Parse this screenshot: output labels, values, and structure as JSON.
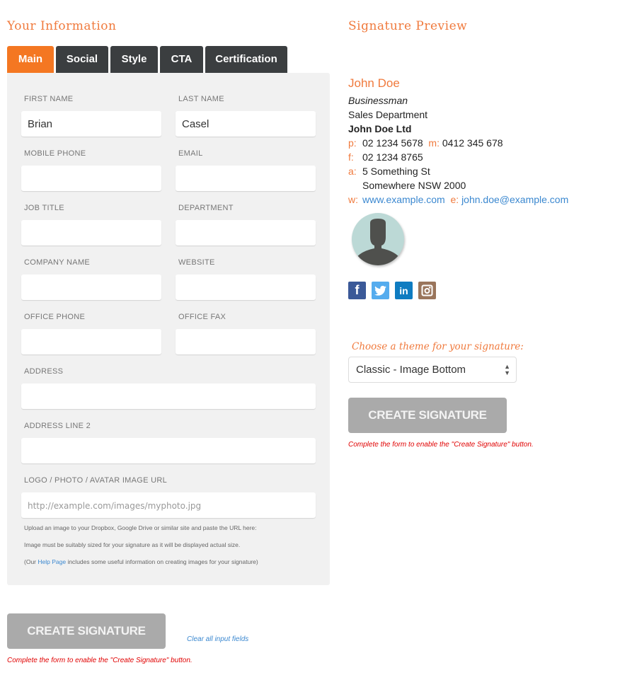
{
  "left": {
    "title": "Your Information",
    "tabs": [
      {
        "label": "Main",
        "active": true
      },
      {
        "label": "Social",
        "active": false
      },
      {
        "label": "Style",
        "active": false
      },
      {
        "label": "CTA",
        "active": false
      },
      {
        "label": "Certification",
        "active": false
      }
    ],
    "fields": {
      "first_name": {
        "label": "FIRST NAME",
        "value": "Brian"
      },
      "last_name": {
        "label": "LAST NAME",
        "value": "Casel"
      },
      "mobile_phone": {
        "label": "MOBILE PHONE",
        "value": ""
      },
      "email": {
        "label": "EMAIL",
        "value": ""
      },
      "job_title": {
        "label": "JOB TITLE",
        "value": ""
      },
      "department": {
        "label": "DEPARTMENT",
        "value": ""
      },
      "company_name": {
        "label": "COMPANY NAME",
        "value": ""
      },
      "website": {
        "label": "WEBSITE",
        "value": ""
      },
      "office_phone": {
        "label": "OFFICE PHONE",
        "value": ""
      },
      "office_fax": {
        "label": "OFFICE FAX",
        "value": ""
      },
      "address": {
        "label": "ADDRESS",
        "value": ""
      },
      "address2": {
        "label": "ADDRESS LINE 2",
        "value": ""
      },
      "image_url": {
        "label": "LOGO / PHOTO / AVATAR IMAGE URL",
        "value": "",
        "placeholder": "http://example.com/images/myphoto.jpg"
      }
    },
    "help": {
      "line1": "Upload an image to your Dropbox, Google Drive or similar site and paste the URL here:",
      "line2": "Image must be suitably sized for your signature as it will be displayed actual size.",
      "line3_prefix": "(Our ",
      "line3_link": "Help Page",
      "line3_suffix": " includes some useful information on creating images for your signature)"
    },
    "create_button": "CREATE SIGNATURE",
    "clear_link": "Clear all input fields",
    "warning": "Complete the form to enable the \"Create Signature\" button."
  },
  "right": {
    "title": "Signature Preview",
    "signature": {
      "name": "John Doe",
      "job_title": "Businessman",
      "department": "Sales Department",
      "company": "John Doe Ltd",
      "phone_label": "p:",
      "phone": "02 1234 5678",
      "mobile_label": "m:",
      "mobile": "0412 345 678",
      "fax_label": "f:",
      "fax": "02 1234 8765",
      "address_label": "a:",
      "address1": "5 Something St",
      "address2": "Somewhere NSW 2000",
      "website_label": "w:",
      "website": "www.example.com",
      "email_label": "e:",
      "email": "john.doe@example.com"
    },
    "social_icons": [
      "facebook",
      "twitter",
      "linkedin",
      "instagram"
    ],
    "theme_label": "Choose a theme for your signature:",
    "theme_selected": "Classic - Image Bottom",
    "create_button": "CREATE SIGNATURE",
    "warning": "Complete the form to enable the \"Create Signature\" button."
  },
  "colors": {
    "accent": "#f47722",
    "heading": "#f07a3d",
    "tab_dark": "#3b3e40",
    "link": "#3b88d0",
    "warning": "#e00000",
    "disabled_button": "#aaaaaa"
  }
}
